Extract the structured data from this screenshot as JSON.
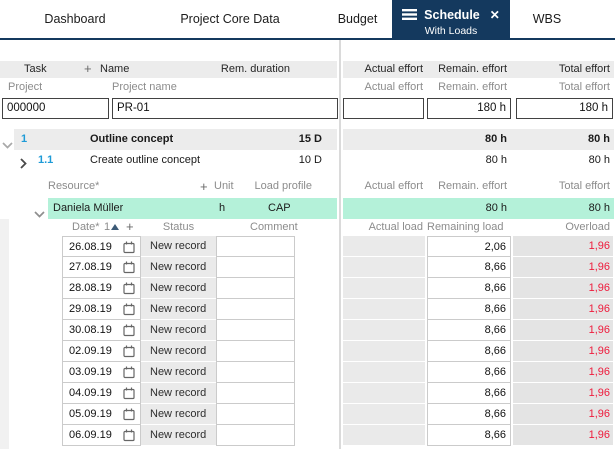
{
  "colors": {
    "navy": "#14395e",
    "accent_blue": "#1e9bd7",
    "teal_row": "#b4f1d9",
    "overload_red": "#ee1b3c"
  },
  "icons": {
    "menu": "menu-icon",
    "close": "close-icon",
    "expand": "chevron-down-icon",
    "collapse": "chevron-right-icon",
    "date_picker": "calendar-icon",
    "sort": "sort-ascending-icon",
    "add": "plus-icon"
  },
  "tabs": {
    "dashboard": "Dashboard",
    "project_core_data": "Project Core Data",
    "budget": "Budget",
    "schedule": "Schedule",
    "schedule_sub": "With Loads",
    "wbs": "WBS"
  },
  "task_table": {
    "col_task": "Task",
    "col_plus": "+",
    "col_name": "Name",
    "col_rem_duration": "Rem. duration",
    "col_actual_effort": "Actual effort",
    "col_remain_effort": "Remain. effort",
    "col_total_effort": "Total effort",
    "sub_project": "Project",
    "sub_project_name": "Project name",
    "sub_actual_effort": "Actual effort",
    "sub_remain_effort": "Remain. effort",
    "sub_total_effort": "Total effort",
    "project_row": {
      "number": "000000",
      "name": "PR-01",
      "actual_effort": "",
      "remain_effort": "180 h",
      "total_effort": "180 h"
    },
    "rows": [
      {
        "number": "1",
        "name": "Outline concept",
        "rem_duration": "15 D",
        "actual_effort": "",
        "remain_effort": "80 h",
        "total_effort": "80 h"
      },
      {
        "number": "1.1",
        "name": "Create outline concept",
        "rem_duration": "10 D",
        "actual_effort": "",
        "remain_effort": "80 h",
        "total_effort": "80 h"
      }
    ]
  },
  "resource_table": {
    "col_resource": "Resource*",
    "col_plus": "+",
    "col_unit": "Unit",
    "col_load_profile": "Load profile",
    "col_actual_effort": "Actual effort",
    "col_remain_effort": "Remain. effort",
    "col_total_effort": "Total effort",
    "row": {
      "name": "Daniela Müller",
      "unit": "h",
      "load_profile": "CAP",
      "actual_effort": "",
      "remain_effort": "80 h",
      "total_effort": "80 h"
    }
  },
  "load_table": {
    "col_date": "Date*",
    "sort_indicator": "1",
    "col_plus": "+",
    "col_status": "Status",
    "col_comment": "Comment",
    "col_actual_load": "Actual load",
    "col_remaining_load": "Remaining load",
    "col_overload": "Overload",
    "rows": [
      {
        "date": "26.08.19",
        "status": "New record",
        "comment": "",
        "actual_load": "",
        "remaining_load": "2,06",
        "overload": "1,96"
      },
      {
        "date": "27.08.19",
        "status": "New record",
        "comment": "",
        "actual_load": "",
        "remaining_load": "8,66",
        "overload": "1,96"
      },
      {
        "date": "28.08.19",
        "status": "New record",
        "comment": "",
        "actual_load": "",
        "remaining_load": "8,66",
        "overload": "1,96"
      },
      {
        "date": "29.08.19",
        "status": "New record",
        "comment": "",
        "actual_load": "",
        "remaining_load": "8,66",
        "overload": "1,96"
      },
      {
        "date": "30.08.19",
        "status": "New record",
        "comment": "",
        "actual_load": "",
        "remaining_load": "8,66",
        "overload": "1,96"
      },
      {
        "date": "02.09.19",
        "status": "New record",
        "comment": "",
        "actual_load": "",
        "remaining_load": "8,66",
        "overload": "1,96"
      },
      {
        "date": "03.09.19",
        "status": "New record",
        "comment": "",
        "actual_load": "",
        "remaining_load": "8,66",
        "overload": "1,96"
      },
      {
        "date": "04.09.19",
        "status": "New record",
        "comment": "",
        "actual_load": "",
        "remaining_load": "8,66",
        "overload": "1,96"
      },
      {
        "date": "05.09.19",
        "status": "New record",
        "comment": "",
        "actual_load": "",
        "remaining_load": "8,66",
        "overload": "1,96"
      },
      {
        "date": "06.09.19",
        "status": "New record",
        "comment": "",
        "actual_load": "",
        "remaining_load": "8,66",
        "overload": "1,96"
      }
    ]
  }
}
